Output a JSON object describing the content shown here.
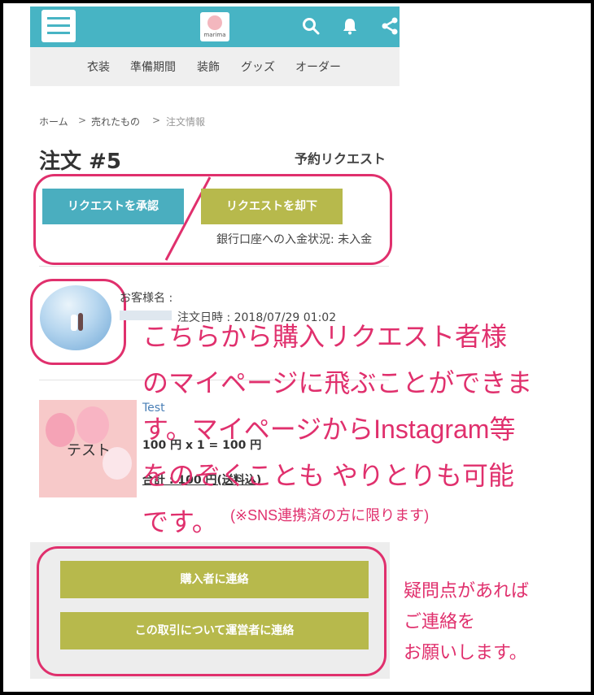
{
  "header": {
    "logo_text": "marima"
  },
  "nav": [
    "衣装",
    "準備期間",
    "装飾",
    "グッズ",
    "オーダー"
  ],
  "breadcrumb": {
    "home": "ホーム",
    "sep1": ">",
    "sold": "売れたもの",
    "sep2": ">",
    "current": "注文情報"
  },
  "order": {
    "title": "注文 #5",
    "status": "予約リクエスト",
    "approve_label": "リクエストを承認",
    "reject_label": "リクエストを却下",
    "bank_status": "銀行口座への入金状況: 未入金"
  },
  "customer": {
    "name_label": "お客様名 :",
    "order_date": "注文日時 : 2018/07/29 01:02"
  },
  "item": {
    "image_text": "テスト",
    "name": "Test",
    "price_line": "100 円 x 1 = 100 円",
    "total": "合計 : 100 円(送料込)"
  },
  "contact": {
    "buyer_label": "購入者に連絡",
    "operator_label": "この取引について運営者に連絡"
  },
  "annotations": {
    "main_lines": [
      "こちらから購入リクエスト者様",
      "のマイページに飛ぶことができま",
      "す。マイページからInstagram等",
      "をのぞくことも やりとりも可能",
      "です。"
    ],
    "note": "(※SNS連携済の方に限ります)",
    "side_lines": [
      "疑問点があれば",
      "ご連絡を",
      "お願いします。"
    ]
  },
  "colors": {
    "teal": "#47b4c4",
    "olive": "#b7b94c",
    "annotation_pink": "#e0306d"
  }
}
